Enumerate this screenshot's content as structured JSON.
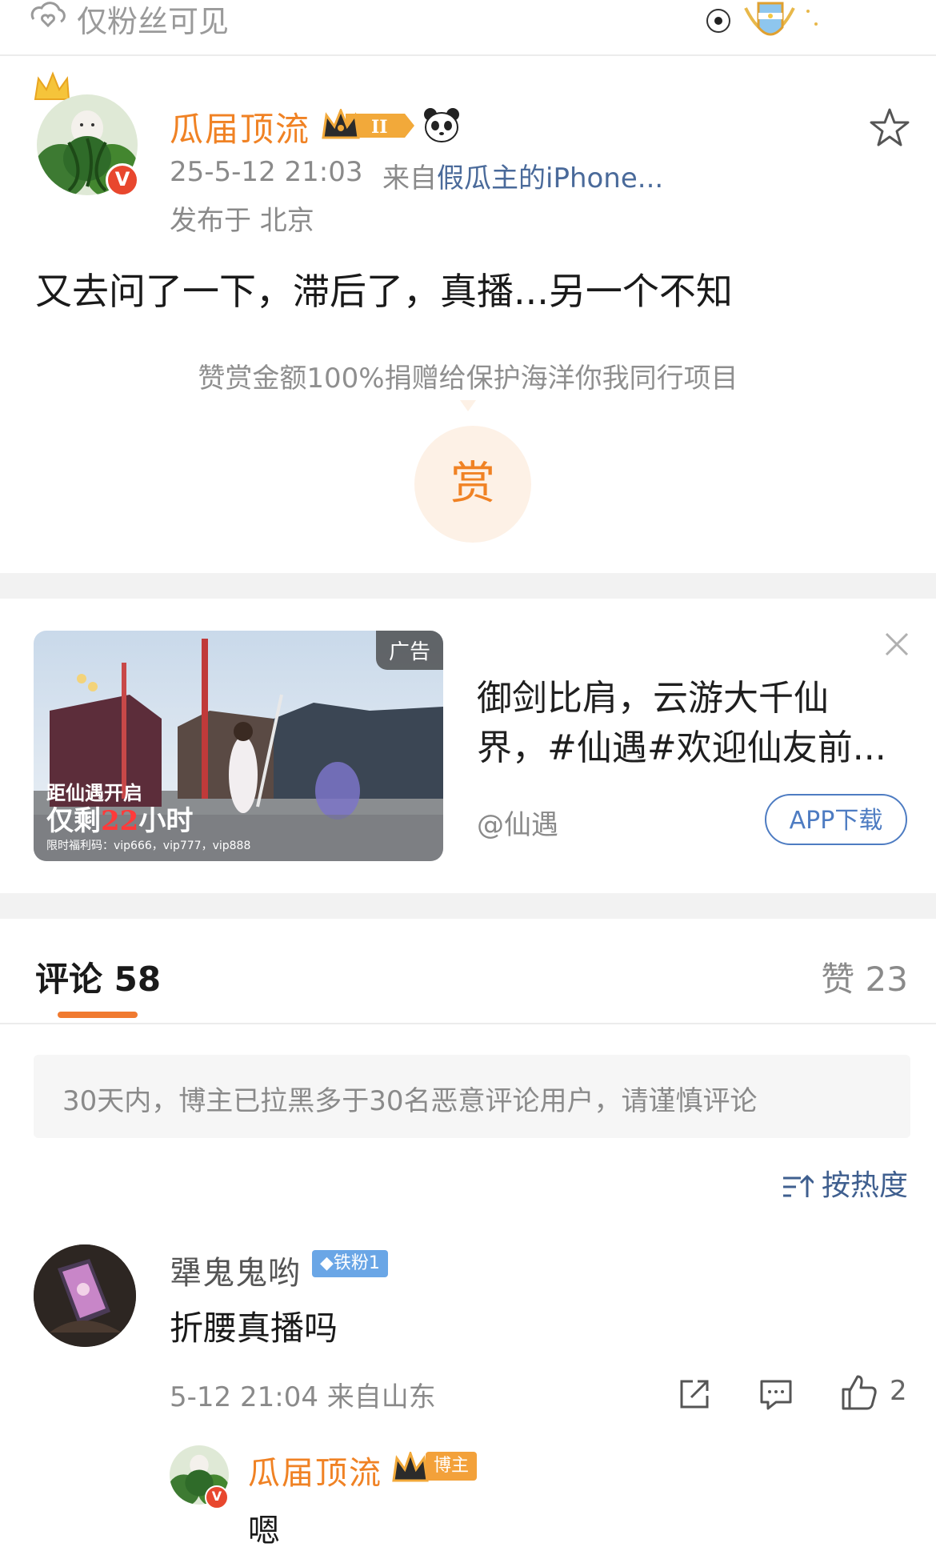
{
  "visibility": {
    "label": "仅粉丝可见"
  },
  "post": {
    "author": "瓜届顶流",
    "level_badge": "II",
    "time": "25-5-12 21:03",
    "source_prefix": "来自",
    "source_device": "假瓜主的iPhone...",
    "location": "发布于 北京",
    "text": "又去问了一下，滞后了，真播...另一个不知",
    "reward_note": "赞赏金额100%捐赠给保护海洋你我同行项目",
    "reward_button": "赏"
  },
  "ad": {
    "tag": "广告",
    "image_line1": "距仙遇开启",
    "image_line2_prefix": "仅剩",
    "image_line2_highlight": "22",
    "image_line2_suffix": "小时",
    "image_line3": "限时福利码：vip666，vip777，vip888",
    "text": "御剑比肩，云游大千仙界，#仙遇#欢迎仙友前...",
    "author": "@仙遇",
    "button": "APP下载"
  },
  "comments": {
    "title": "评论 58",
    "likes": "赞 23",
    "notice": "30天内，博主已拉黑多于30名恶意评论用户，请谨慎评论",
    "sort_label": "按热度",
    "items": [
      {
        "name": "犟鬼鬼哟",
        "badge": "铁粉1",
        "text": "折腰真播吗",
        "time": "5-12 21:04",
        "location": "来自山东",
        "like_count": "2",
        "reply": {
          "name": "瓜届顶流",
          "badge": "博主",
          "text": "嗯"
        }
      }
    ]
  },
  "colors": {
    "accent_orange": "#f08224",
    "link_blue": "#4e7cc2",
    "verified_red": "#e8472e",
    "fan_badge_blue": "#6aa6e6"
  }
}
